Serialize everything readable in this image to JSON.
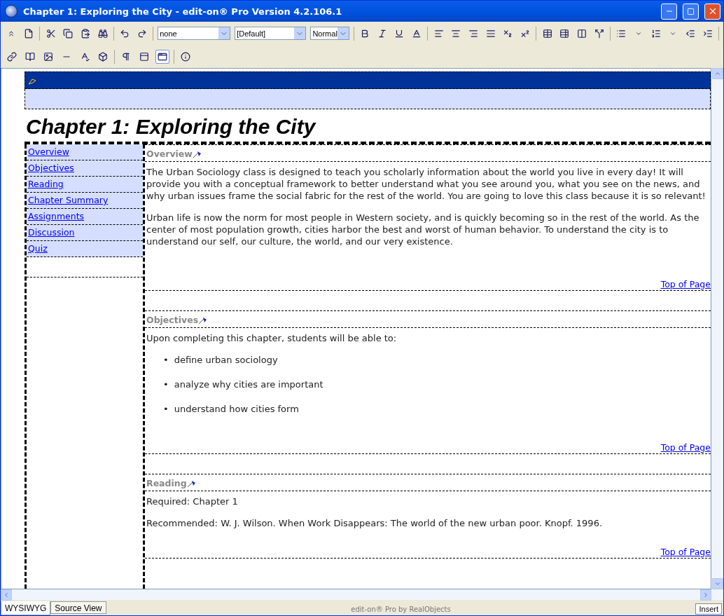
{
  "window": {
    "title": "Chapter 1: Exploring the City - edit-on® Pro Version 4.2.106.1"
  },
  "toolbar": {
    "style_select": "none",
    "font_select": "[Default]",
    "size_select": "Normal"
  },
  "view_toggles": [
    {
      "pressed": false
    },
    {
      "pressed": false
    },
    {
      "pressed": true
    }
  ],
  "document": {
    "heading": "Chapter 1: Exploring the City",
    "nav": [
      {
        "label": "Overview"
      },
      {
        "label": "Objectives"
      },
      {
        "label": "Reading"
      },
      {
        "label": "Chapter Summary"
      },
      {
        "label": "Assignments"
      },
      {
        "label": "Discussion"
      },
      {
        "label": "Quiz"
      }
    ],
    "sections": [
      {
        "title": "Overview",
        "blocks": [
          {
            "kind": "paragraph",
            "text": "The Urban Sociology class is designed to teach you scholarly information about the world you live in every day! It will provide you with a conceptual framework to better understand what you see around you, what you see on the news, and why urban issues frame the social fabric for the rest of the world. You are going to love this class because it is so relevant!"
          },
          {
            "kind": "paragraph",
            "text": "Urban life is now the norm for most people in Western society, and is quickly becoming so in the rest of the world. As the center of most population growth, cities harbor the best and worst of human behavior. To understand the city is to understand our self, our culture, the world, and our very existence."
          }
        ],
        "top_link": "Top of Page"
      },
      {
        "title": "Objectives",
        "blocks": [
          {
            "kind": "paragraph",
            "text": "Upon completing this chapter, students will be able to:"
          },
          {
            "kind": "list",
            "items": [
              {
                "marker": "•",
                "text": "define urban sociology"
              },
              {
                "marker": "•",
                "text": "analyze why cities are important"
              },
              {
                "marker": "•",
                "text": "understand how cities form"
              }
            ]
          }
        ],
        "top_link": "Top of Page"
      },
      {
        "title": "Reading",
        "blocks": [
          {
            "kind": "paragraph",
            "text": "Required: Chapter 1"
          },
          {
            "kind": "paragraph",
            "text": "Recommended: W. J. Wilson.  When Work Disappears: The world of the new urban poor.  Knopf. 1996."
          }
        ],
        "top_link": "Top of Page"
      }
    ]
  },
  "view_tabs": [
    {
      "label": "WYSIWYG",
      "selected": true
    },
    {
      "label": "Source View",
      "selected": false
    }
  ],
  "status_bar": {
    "credit": "edit-on® Pro by RealObjects",
    "mode": "Insert"
  }
}
